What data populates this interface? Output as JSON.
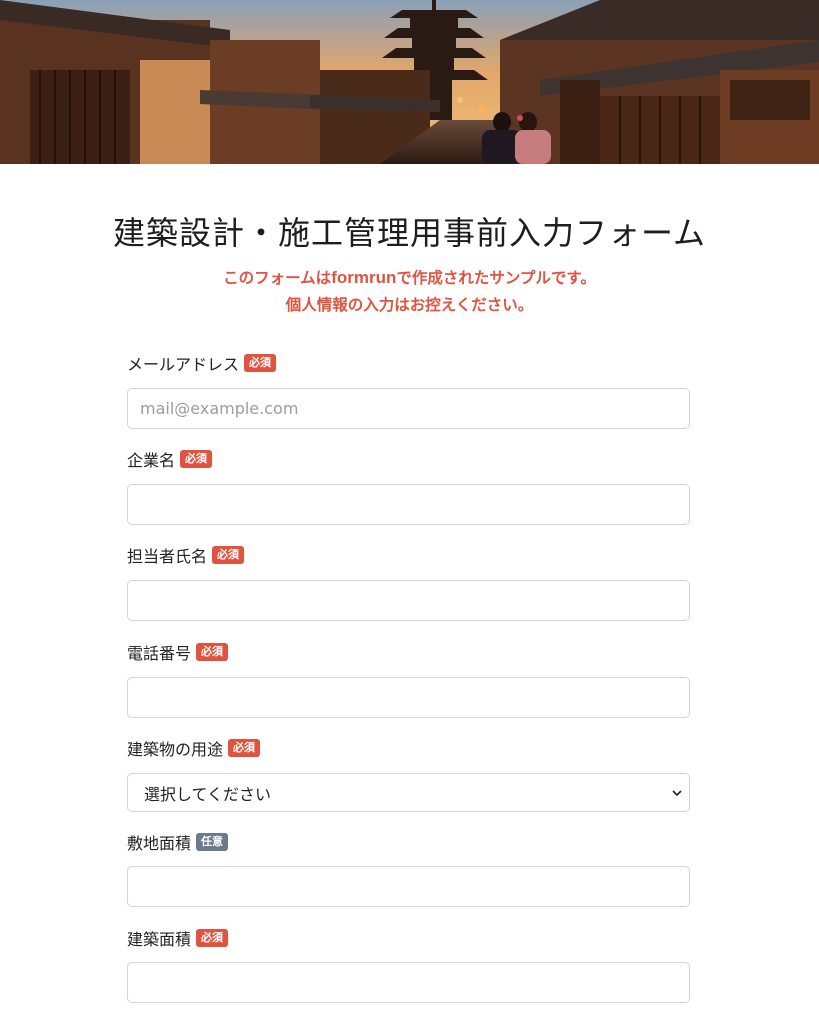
{
  "form": {
    "title": "建築設計・施工管理用事前入力フォーム",
    "notice_line1_before": "このフォームは",
    "notice_line1_brand": "formrun",
    "notice_line1_after": "で作成されたサンプルです。",
    "notice_line2": "個人情報の入力はお控えください。",
    "accent_color": "#e0533f",
    "optional_badge_color": "#6c7b8b"
  },
  "fields": {
    "email": {
      "label": "メールアドレス",
      "badge": "必須",
      "value": "",
      "placeholder": "mail@example.com"
    },
    "company": {
      "label": "企業名",
      "badge": "必須",
      "value": ""
    },
    "contact_name": {
      "label": "担当者氏名",
      "badge": "必須",
      "value": ""
    },
    "phone": {
      "label": "電話番号",
      "badge": "必須",
      "value": ""
    },
    "building_use": {
      "label": "建築物の用途",
      "badge": "必須",
      "selected": "選択してください"
    },
    "site_area": {
      "label": "敷地面積",
      "badge": "任意",
      "value": ""
    },
    "building_area": {
      "label": "建築面積",
      "badge": "必須",
      "value": ""
    }
  }
}
